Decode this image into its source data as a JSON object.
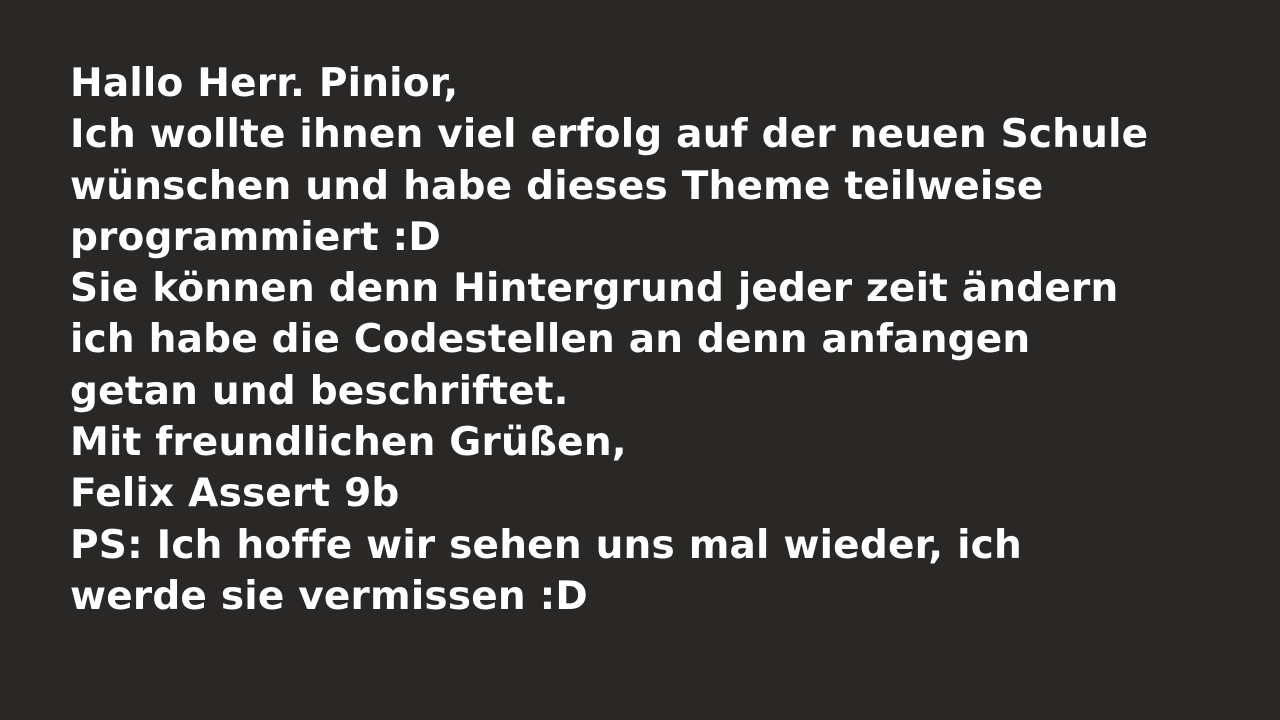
{
  "letter": {
    "lines": [
      "Hallo Herr. Pinior,",
      "Ich wollte ihnen viel erfolg auf der neuen Schule",
      "wünschen und habe dieses Theme teilweise",
      "programmiert :D",
      "Sie können denn Hintergrund jeder zeit ändern",
      "ich habe die Codestellen an denn anfangen",
      "getan und beschriftet.",
      "Mit freundlichen Grüßen,",
      "Felix Assert 9b",
      "PS: Ich hoffe wir sehen uns mal wieder, ich",
      "werde sie vermissen :D"
    ]
  },
  "colors": {
    "background": "#2a2727",
    "text": "#ffffff"
  }
}
